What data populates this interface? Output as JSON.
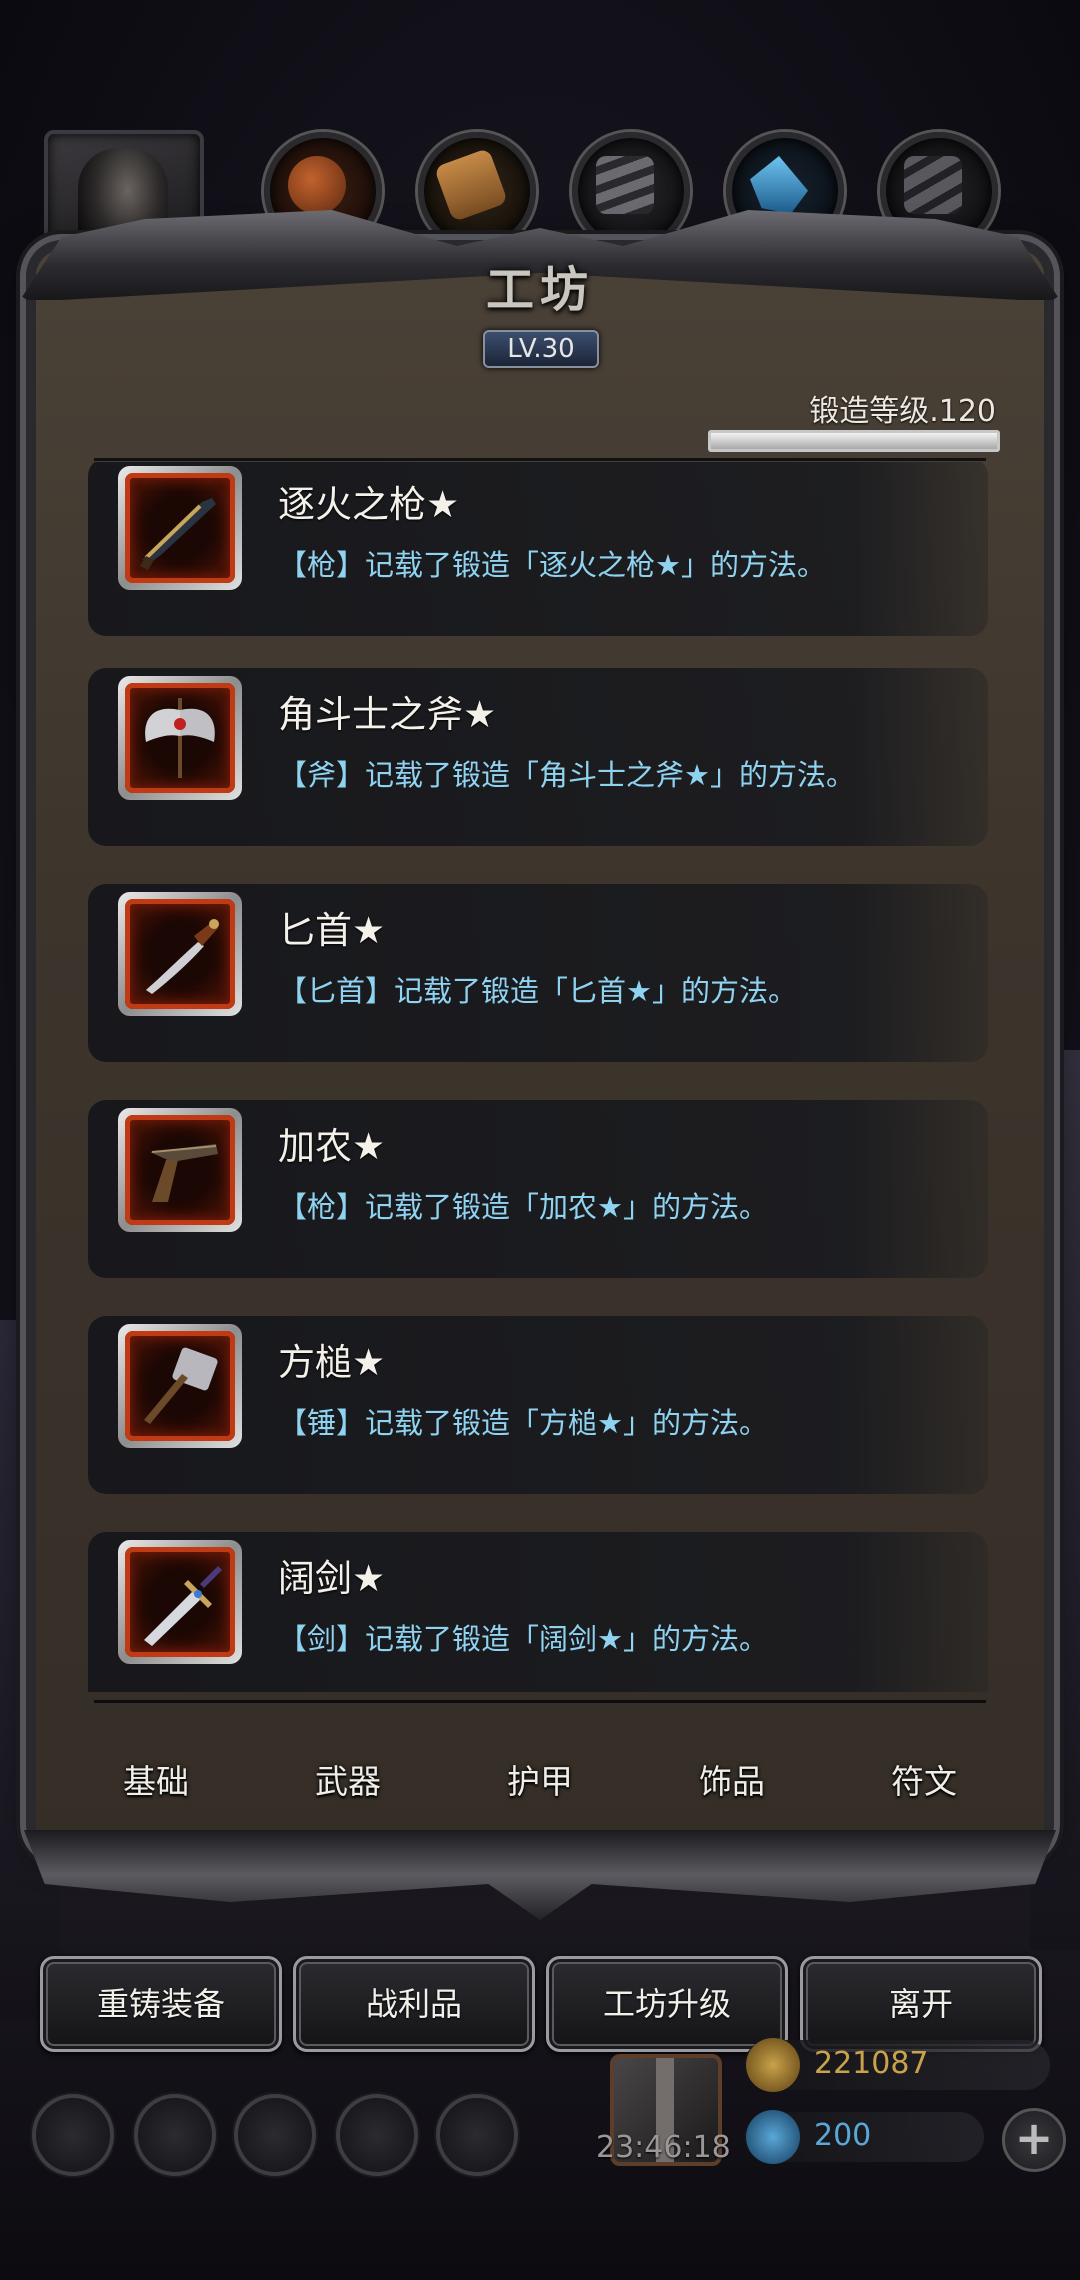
{
  "header": {
    "title": "工坊",
    "level_badge": "LV.30",
    "forge_level_text": "锻造等级.120",
    "forge_progress_fraction": 1.0
  },
  "top_categories": [
    {
      "icon": "leather-icon",
      "color": "#a0502a"
    },
    {
      "icon": "wood-icon",
      "color": "#b07a3c"
    },
    {
      "icon": "iron-icon",
      "color": "#5a5a5e"
    },
    {
      "icon": "crystal-icon",
      "color": "#2a7fb8"
    },
    {
      "icon": "steel-icon",
      "color": "#4a4a4e"
    }
  ],
  "recipes": [
    {
      "name": "逐火之枪★",
      "desc": "【枪】记载了锻造「逐火之枪★」的方法。",
      "icon": "musket-icon"
    },
    {
      "name": "角斗士之斧★",
      "desc": "【斧】记载了锻造「角斗士之斧★」的方法。",
      "icon": "battle-axe-icon"
    },
    {
      "name": "匕首★",
      "desc": "【匕首】记载了锻造「匕首★」的方法。",
      "icon": "dagger-icon"
    },
    {
      "name": "加农★",
      "desc": "【枪】记载了锻造「加农★」的方法。",
      "icon": "pistol-icon"
    },
    {
      "name": "方槌★",
      "desc": "【锤】记载了锻造「方槌★」的方法。",
      "icon": "hammer-icon"
    },
    {
      "name": "阔剑★",
      "desc": "【剑】记载了锻造「阔剑★」的方法。",
      "icon": "broadsword-icon"
    }
  ],
  "tabs": [
    "基础",
    "武器",
    "护甲",
    "饰品",
    "符文"
  ],
  "actions": [
    "重铸装备",
    "战利品",
    "工坊升级",
    "离开"
  ],
  "hud": {
    "timer": "23:46:18",
    "gold": "221087",
    "gems": "200",
    "gold_color": "#c9a24a",
    "gem_color": "#5aa7d8"
  }
}
